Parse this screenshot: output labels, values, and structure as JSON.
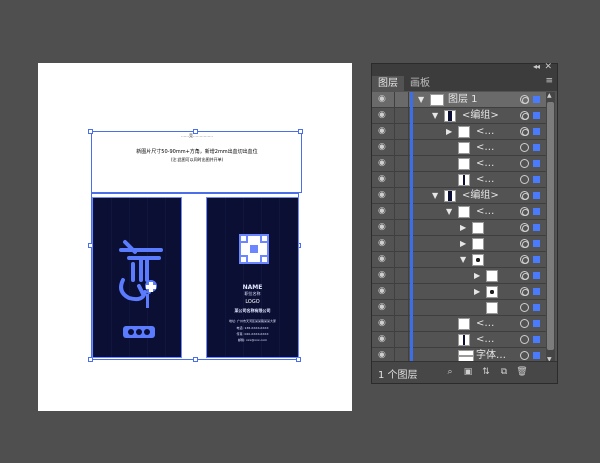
{
  "artboard": {
    "text_lines": [
      "……竞……………",
      "新图片尺寸50-90mm+方角，新增2mm出血切出血位",
      "(注:此图可以同时出图并开单)"
    ],
    "card_back": {
      "name": "NAME",
      "title": "职位名称",
      "logo": "LOGO",
      "company": "某公司名称有限公司",
      "lines": [
        "地址: 广州市天河区某某路某某大厦",
        "电话: 138-XXXX-XXXX",
        "传真: 020-XXXX-XXXX",
        "邮箱: xxx@xxx.com"
      ]
    }
  },
  "panel": {
    "collapse_label": "◂◂",
    "close_label": "✕",
    "tabs": [
      {
        "label": "图层"
      },
      {
        "label": "画板"
      }
    ],
    "menu_icon": "≡",
    "rows": [
      {
        "label": "图层 1",
        "type": "layer",
        "twisty": "expanded",
        "indent": 0,
        "thumb": "layer",
        "selected": true
      },
      {
        "label": "<编组>",
        "type": "group",
        "twisty": "expanded",
        "indent": 1,
        "thumb": "dark",
        "selected": false
      },
      {
        "label": "<…",
        "type": "group",
        "twisty": "collapsed",
        "indent": 2,
        "thumb": "white",
        "selected": false
      },
      {
        "label": "<…",
        "type": "item",
        "twisty": "none",
        "indent": 2,
        "thumb": "white",
        "selected": false
      },
      {
        "label": "<…",
        "type": "item",
        "twisty": "none",
        "indent": 2,
        "thumb": "white",
        "selected": false
      },
      {
        "label": "<…",
        "type": "item",
        "twisty": "none",
        "indent": 2,
        "thumb": "bar",
        "selected": false
      },
      {
        "label": "<编组>",
        "type": "group",
        "twisty": "expanded",
        "indent": 1,
        "thumb": "dark",
        "selected": false
      },
      {
        "label": "<…",
        "type": "group",
        "twisty": "expanded",
        "indent": 2,
        "thumb": "white",
        "selected": false
      },
      {
        "label": "",
        "type": "group",
        "twisty": "collapsed",
        "indent": 3,
        "thumb": "white",
        "selected": false
      },
      {
        "label": "",
        "type": "group",
        "twisty": "collapsed",
        "indent": 3,
        "thumb": "white",
        "selected": false
      },
      {
        "label": "",
        "type": "group",
        "twisty": "expanded",
        "indent": 3,
        "thumb": "cross",
        "selected": false
      },
      {
        "label": "",
        "type": "group",
        "twisty": "collapsed",
        "indent": 4,
        "thumb": "white",
        "selected": false
      },
      {
        "label": "",
        "type": "group",
        "twisty": "collapsed",
        "indent": 4,
        "thumb": "cross",
        "selected": false
      },
      {
        "label": "",
        "type": "item",
        "twisty": "none",
        "indent": 4,
        "thumb": "white",
        "selected": false
      },
      {
        "label": "<…",
        "type": "item",
        "twisty": "none",
        "indent": 2,
        "thumb": "white",
        "selected": false
      },
      {
        "label": "<…",
        "type": "item",
        "twisty": "none",
        "indent": 2,
        "thumb": "bar",
        "selected": false
      },
      {
        "label": "字体…",
        "type": "item",
        "twisty": "none",
        "indent": 2,
        "thumb": "text",
        "selected": false
      }
    ],
    "footer": {
      "layer_count": "1 个图层",
      "buttons": [
        {
          "name": "locate-object-icon",
          "glyph": "⌕"
        },
        {
          "name": "make-clipping-mask-icon",
          "glyph": "▣"
        },
        {
          "name": "create-sublayer-icon",
          "glyph": "⇅"
        },
        {
          "name": "create-new-layer-icon",
          "glyph": "⧉"
        },
        {
          "name": "delete-layer-icon",
          "glyph": "🗑"
        }
      ]
    }
  }
}
